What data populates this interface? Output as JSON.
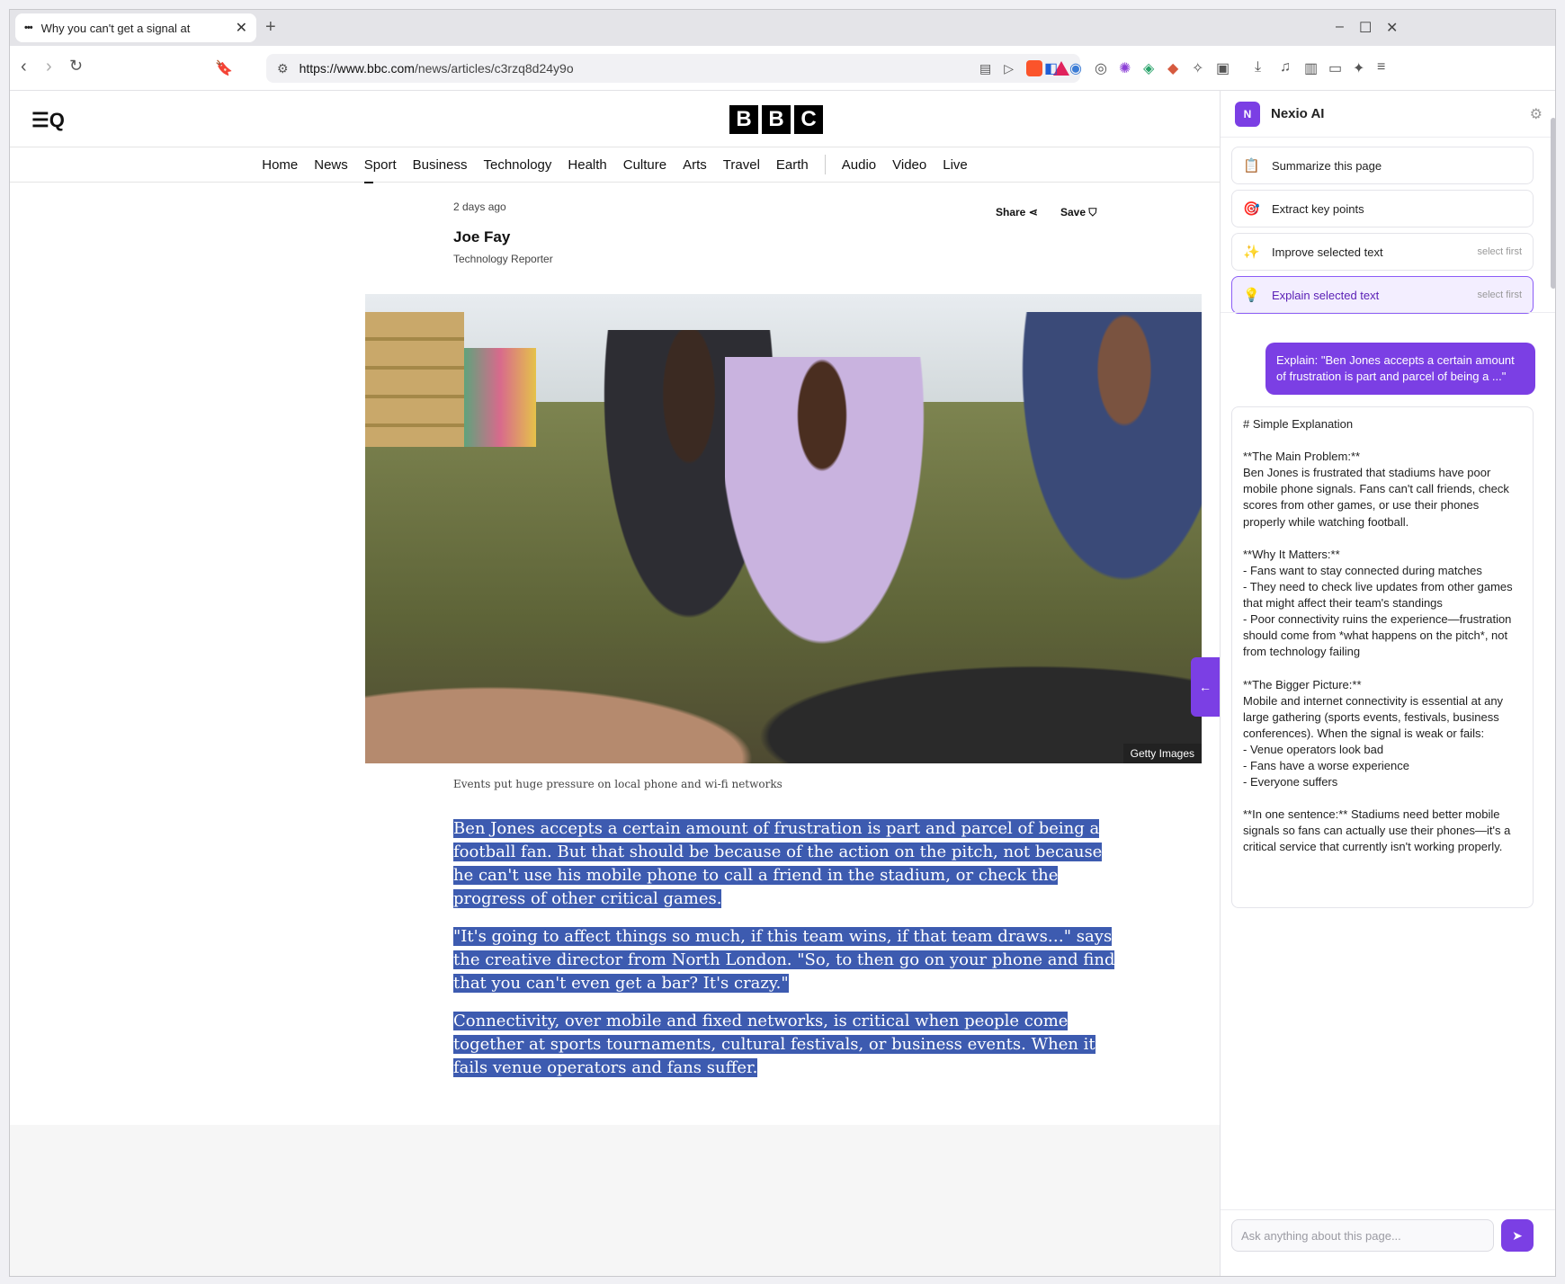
{
  "browser": {
    "tab_title": "Why you can't get a signal at",
    "tab_favicon": "•••",
    "tab_close": "✕",
    "new_tab": "+",
    "url_domain": "https://www.bbc.com",
    "url_path": "/news/articles/c3rzq8d24y9o",
    "minimize": "–",
    "maximize": "☐",
    "close": "✕"
  },
  "bbc": {
    "logo_letters": [
      "B",
      "B",
      "C"
    ],
    "menu_icon": "☰Q",
    "nav": [
      "Home",
      "News",
      "Sport",
      "Business",
      "Technology",
      "Health",
      "Culture",
      "Arts",
      "Travel",
      "Earth",
      "Audio",
      "Video",
      "Live"
    ]
  },
  "article": {
    "time": "2 days ago",
    "share_label": "Share",
    "save_label": "Save",
    "author": "Joe Fay",
    "role": "Technology Reporter",
    "image_credit": "Getty Images",
    "caption": "Events put huge pressure on local phone and wi-fi networks",
    "paragraphs": [
      "Ben Jones accepts a certain amount of frustration is part and parcel of being a football fan. But that should be because of the action on the pitch, not because he can't use his mobile phone to call a friend in the stadium, or check the progress of other critical games.",
      "\"It's going to affect things so much, if this team wins, if that team draws…\" says the creative director from North London. \"So, to then go on your phone and find that you can't even get a bar? It's crazy.\"",
      "Connectivity, over mobile and fixed networks, is critical when people come together at sports tournaments, cultural festivals, or business events. When it fails venue operators and fans suffer."
    ]
  },
  "sidebar": {
    "logo": "N",
    "name": "Nexio AI",
    "actions": [
      {
        "icon": "📋",
        "label": "Summarize this page",
        "hint": ""
      },
      {
        "icon": "🎯",
        "label": "Extract key points",
        "hint": ""
      },
      {
        "icon": "✨",
        "label": "Improve selected text",
        "hint": "select first"
      },
      {
        "icon": "💡",
        "label": "Explain selected text",
        "hint": "select first"
      }
    ],
    "user_message": "Explain: \"Ben Jones accepts a certain amount of frustration is part and parcel of being a ...\"",
    "ai_message": "# Simple Explanation\n\n**The Main Problem:**\nBen Jones is frustrated that stadiums have poor mobile phone signals. Fans can't call friends, check scores from other games, or use their phones properly while watching football.\n\n**Why It Matters:**\n- Fans want to stay connected during matches\n- They need to check live updates from other games that might affect their team's standings\n- Poor connectivity ruins the experience—frustration should come from *what happens on the pitch*, not from technology failing\n\n**The Bigger Picture:**\nMobile and internet connectivity is essential at any large gathering (sports events, festivals, business conferences). When the signal is weak or fails:\n- Venue operators look bad\n- Fans have a worse experience\n- Everyone suffers\n\n**In one sentence:** Stadiums need better mobile signals so fans can actually use their phones—it's a critical service that currently isn't working properly.",
    "input_placeholder": "Ask anything about this page..."
  },
  "colors": {
    "accent": "#7b3fe4",
    "selection": "#3d5bb0"
  }
}
